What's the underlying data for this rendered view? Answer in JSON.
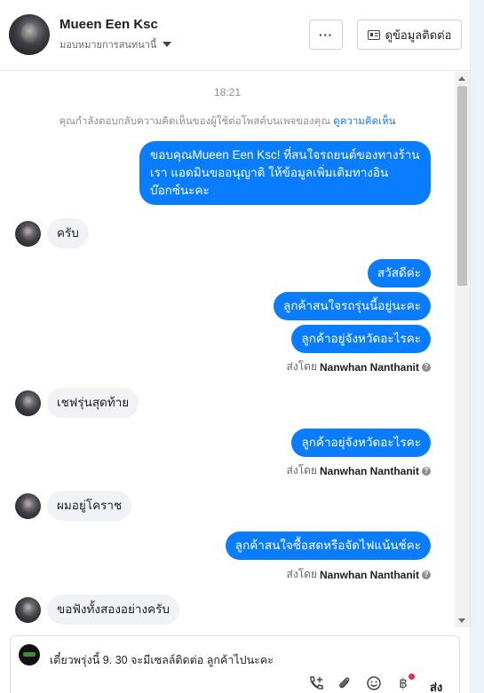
{
  "header": {
    "name": "Mueen Een Ksc",
    "assign_label": "มอบหมายการสนทนานี้",
    "more_label": "···",
    "contact_label": "ดูข้อมูลติดต่อ"
  },
  "chat": {
    "time": "18:21",
    "notice_text": "คุณกำลังตอบกลับความคิดเห็นของผู้ใช้ต่อโพสต์บนเพจของคุณ",
    "notice_link": "ดูความคิดเห็น",
    "messages": [
      {
        "dir": "out",
        "lines": [
          "ขอบคุณMueen Een Ksc! ที่สนใจรถยนต์ของทางร้าน",
          "เรา แอดมินขออนุญาติ ให้ข้อมูลเพิ่มเติมทางอิน",
          "บ๊อกซ์นะคะ"
        ]
      },
      {
        "dir": "in",
        "text": "ครับ"
      },
      {
        "dir": "out",
        "text": "สวัสดีค่ะ"
      },
      {
        "dir": "out",
        "text": "ลูกค้าสนใจรถรุ่นนี้อยู่นะคะ"
      },
      {
        "dir": "out",
        "text": "ลูกค้าอยู่จังหวัดอะไรคะ"
      },
      {
        "dir": "in",
        "text": "เชฟรุ่นสุดท้าย"
      },
      {
        "dir": "out",
        "text": "ลูกค้าอยุ่จังหวัดอะไรคะ"
      },
      {
        "dir": "in",
        "text": "ผมอยู่โคราช"
      },
      {
        "dir": "out",
        "text": "ลูกค้าสนใจซื้อสดหรือจัดไฟแน้นช์คะ"
      },
      {
        "dir": "in",
        "text": "ขอฟังทั้งสองอย่างครับ"
      }
    ],
    "sent_by_prefix": "ส่งโดย",
    "sent_by_name": "Nanwhan Nanthanit",
    "info_glyph": "?"
  },
  "composer": {
    "text": "เดี๋ยวพรุ่งนี้ 9. 30 จะมีเซลล์ติดต่อ ลูกค้าไปนะคะ",
    "send_label": "ส่ง",
    "currency_glyph": "฿"
  },
  "colors": {
    "outgoing_bubble": "#0a7cff",
    "incoming_bubble": "#f0f2f5",
    "link": "#1877f2",
    "badge": "#f02849"
  }
}
